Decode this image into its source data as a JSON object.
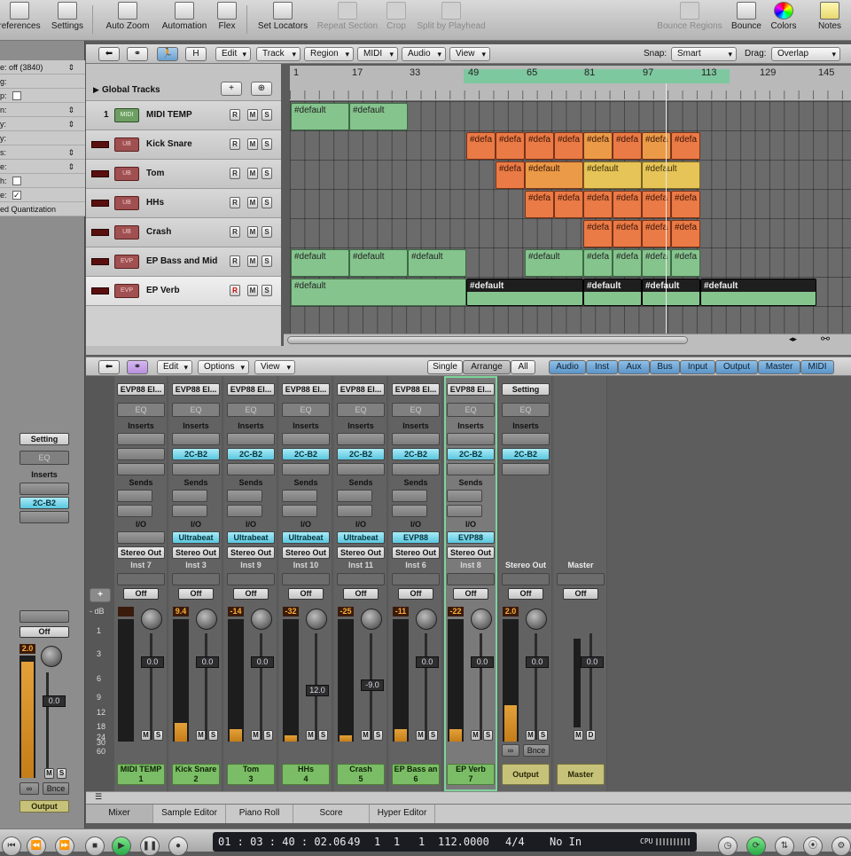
{
  "toolbar": {
    "preferences": "references",
    "settings": "Settings",
    "auto_zoom": "Auto Zoom",
    "automation": "Automation",
    "flex": "Flex",
    "set_locators": "Set Locators",
    "repeat_section": "Repeat Section",
    "crop": "Crop",
    "split_by_playhead": "Split by Playhead",
    "bounce_regions": "Bounce Regions",
    "bounce": "Bounce",
    "colors": "Colors",
    "notes": "Notes"
  },
  "inspector": {
    "params": [
      "e: off (3840)",
      "g:",
      "p:",
      "n:",
      "y:",
      "y:",
      "s:",
      "e:",
      "h:",
      "e:",
      "ed Quantization"
    ],
    "setting": "Setting",
    "eq": "EQ",
    "inserts": "Inserts",
    "insert_plugin": "2C-B2",
    "off": "Off",
    "fader_value": "0.0",
    "peak": "2.0",
    "bnce": "Bnce",
    "output": "Output"
  },
  "arrange": {
    "edit": "Edit",
    "track": "Track",
    "region": "Region",
    "midi": "MIDI",
    "audio": "Audio",
    "view": "View",
    "snap_label": "Snap:",
    "snap_value": "Smart",
    "drag_label": "Drag:",
    "drag_value": "Overlap",
    "h_button": "H",
    "global_tracks": "Global Tracks",
    "ruler": [
      "1",
      "17",
      "33",
      "49",
      "65",
      "81",
      "97",
      "113",
      "129",
      "145"
    ]
  },
  "tracks": [
    {
      "num": "1",
      "name": "MIDI TEMP",
      "icon": "MIDI"
    },
    {
      "num": "",
      "name": "Kick Snare",
      "icon": "UB"
    },
    {
      "num": "",
      "name": "Tom",
      "icon": "UB"
    },
    {
      "num": "",
      "name": "HHs",
      "icon": "UB"
    },
    {
      "num": "",
      "name": "Crash",
      "icon": "UB"
    },
    {
      "num": "",
      "name": "EP Bass and Mid",
      "icon": "EVP"
    },
    {
      "num": "",
      "name": "EP Verb",
      "icon": "EVP"
    }
  ],
  "region_label": "#default",
  "region_label_short": "#defa",
  "mixer_hdr": {
    "edit": "Edit",
    "options": "Options",
    "view": "View",
    "single": "Single",
    "arrange": "Arrange",
    "all": "All",
    "groups": [
      "Audio",
      "Inst",
      "Aux",
      "Bus",
      "Input",
      "Output",
      "Master",
      "MIDI"
    ]
  },
  "strips": [
    {
      "setting": "EVP88 El...",
      "eq": "EQ",
      "inserts": "Inserts",
      "plugin": "",
      "sends": "Sends",
      "io": "I/O",
      "input": "",
      "output": "Stereo Out",
      "chan": "Inst 7",
      "off": "Off",
      "peak": "",
      "fader": "0.0",
      "name1": "MIDI TEMP",
      "name2": "1",
      "level": 0.0
    },
    {
      "setting": "EVP88 El...",
      "eq": "EQ",
      "inserts": "Inserts",
      "plugin": "2C-B2",
      "sends": "Sends",
      "io": "I/O",
      "input": "Ultrabeat",
      "output": "Stereo Out",
      "chan": "Inst 3",
      "off": "Off",
      "peak": "9.4",
      "fader": "0.0",
      "name1": "Kick Snare",
      "name2": "2",
      "level": 0.15
    },
    {
      "setting": "EVP88 El...",
      "eq": "EQ",
      "inserts": "Inserts",
      "plugin": "2C-B2",
      "sends": "Sends",
      "io": "I/O",
      "input": "Ultrabeat",
      "output": "Stereo Out",
      "chan": "Inst 9",
      "off": "Off",
      "peak": "-14",
      "fader": "0.0",
      "name1": "Tom",
      "name2": "3",
      "level": 0.1
    },
    {
      "setting": "EVP88 El...",
      "eq": "EQ",
      "inserts": "Inserts",
      "plugin": "2C-B2",
      "sends": "Sends",
      "io": "I/O",
      "input": "Ultrabeat",
      "output": "Stereo Out",
      "chan": "Inst 10",
      "off": "Off",
      "peak": "-32",
      "fader": "12.0",
      "name1": "HHs",
      "name2": "4",
      "level": 0.05
    },
    {
      "setting": "EVP88 El...",
      "eq": "EQ",
      "inserts": "Inserts",
      "plugin": "2C-B2",
      "sends": "Sends",
      "io": "I/O",
      "input": "Ultrabeat",
      "output": "Stereo Out",
      "chan": "Inst 11",
      "off": "Off",
      "peak": "-25",
      "fader": "-9.0",
      "name1": "Crash",
      "name2": "5",
      "level": 0.05
    },
    {
      "setting": "EVP88 El...",
      "eq": "EQ",
      "inserts": "Inserts",
      "plugin": "2C-B2",
      "sends": "Sends",
      "io": "I/O",
      "input": "EVP88",
      "output": "Stereo Out",
      "chan": "Inst 6",
      "off": "Off",
      "peak": "-11",
      "fader": "0.0",
      "name1": "EP Bass an",
      "name2": "6",
      "level": 0.1
    },
    {
      "setting": "EVP88 El...",
      "eq": "EQ",
      "inserts": "Inserts",
      "plugin": "2C-B2",
      "sends": "Sends",
      "io": "I/O",
      "input": "EVP88",
      "output": "Stereo Out",
      "chan": "Inst 8",
      "off": "Off",
      "peak": "-22",
      "fader": "0.0",
      "name1": "EP Verb",
      "name2": "7",
      "level": 0.1
    },
    {
      "setting": "Setting",
      "eq": "EQ",
      "inserts": "Inserts",
      "plugin": "2C-B2",
      "sends": "",
      "io": "",
      "input": "",
      "output": "",
      "chan": "Stereo Out",
      "off": "Off",
      "peak": "2.0",
      "fader": "0.0",
      "name1": "Output",
      "name2": "",
      "level": 0.3
    },
    {
      "setting": "",
      "eq": "",
      "inserts": "",
      "plugin": "",
      "sends": "",
      "io": "",
      "input": "",
      "output": "",
      "chan": "Master",
      "off": "Off",
      "peak": "",
      "fader": "0.0",
      "name1": "Master",
      "name2": "",
      "level": 0.0
    }
  ],
  "db_scale": [
    "- dB",
    "1",
    "3",
    "6",
    "9",
    "12",
    "18",
    "24",
    "30",
    "60"
  ],
  "bnce": "Bnce",
  "bottom_tabs": [
    "Mixer",
    "Sample Editor",
    "Piano Roll",
    "Score",
    "Hyper Editor"
  ],
  "transport": {
    "time": "01 : 03 : 40 : 02.06",
    "bars": "49",
    "beat": "1",
    "div": "1",
    "tick": "1",
    "tempo": "112.0000",
    "signature": "4/4",
    "in": "No In",
    "cpu": "CPU"
  },
  "colors": {
    "region_green": "#86c48e",
    "region_orange": "#ea7a46",
    "region_yellow": "#e6c457",
    "plugin_blue": "#5ac6de",
    "selected_outline": "#7dd39a"
  }
}
